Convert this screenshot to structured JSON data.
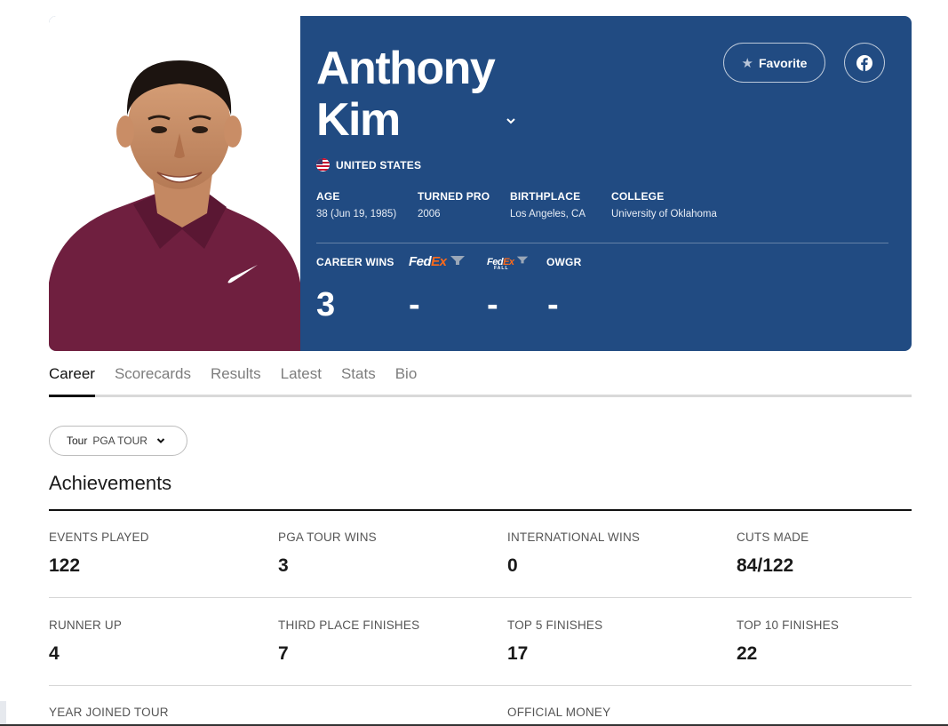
{
  "player": {
    "first_name": "Anthony",
    "last_name": "Kim",
    "country": "UNITED STATES"
  },
  "actions": {
    "favorite_label": "Favorite"
  },
  "info": [
    {
      "label": "AGE",
      "value": "38 (Jun 19, 1985)"
    },
    {
      "label": "TURNED PRO",
      "value": "2006"
    },
    {
      "label": "BIRTHPLACE",
      "value": "Los Angeles, CA"
    },
    {
      "label": "COLLEGE",
      "value": "University of Oklahoma"
    }
  ],
  "stats": {
    "career_wins_label": "CAREER WINS",
    "career_wins_value": "3",
    "fedex_cup_value": "-",
    "fedex_fall_value": "-",
    "owgr_label": "OWGR",
    "owgr_value": "-"
  },
  "fedex_logo": {
    "fed": "Fed",
    "ex": "Ex",
    "fall": "FALL"
  },
  "tabs": [
    "Career",
    "Scorecards",
    "Results",
    "Latest",
    "Stats",
    "Bio"
  ],
  "tour_select": {
    "label": "Tour",
    "value": "PGA TOUR"
  },
  "achievements": {
    "title": "Achievements",
    "rows": [
      [
        {
          "label": "EVENTS PLAYED",
          "value": "122"
        },
        {
          "label": "PGA TOUR WINS",
          "value": "3"
        },
        {
          "label": "INTERNATIONAL WINS",
          "value": "0"
        },
        {
          "label": "CUTS MADE",
          "value": "84/122"
        }
      ],
      [
        {
          "label": "RUNNER UP",
          "value": "4"
        },
        {
          "label": "THIRD PLACE FINISHES",
          "value": "7"
        },
        {
          "label": "TOP 5 FINISHES",
          "value": "17"
        },
        {
          "label": "TOP 10 FINISHES",
          "value": "22"
        }
      ],
      [
        {
          "label": "YEAR JOINED TOUR"
        },
        {
          "label": "OFFICIAL MONEY"
        }
      ]
    ]
  },
  "colors": {
    "hero_bg": "#214b82",
    "fedex_orange": "#ff6a1a"
  },
  "icons": [
    "star-icon",
    "facebook-icon",
    "chevron-down-icon",
    "us-flag-icon",
    "nike-logo-icon"
  ]
}
